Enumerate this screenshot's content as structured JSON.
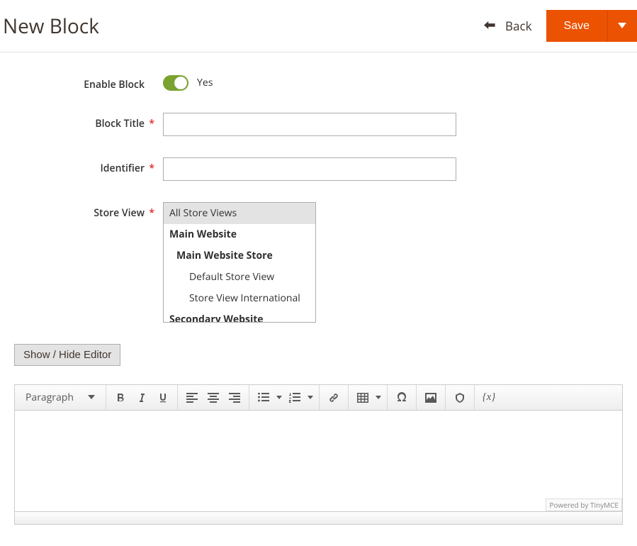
{
  "header": {
    "title": "New Block",
    "back": "Back",
    "save": "Save"
  },
  "fields": {
    "enable": {
      "label": "Enable Block",
      "value_label": "Yes"
    },
    "title": {
      "label": "Block Title"
    },
    "identifier": {
      "label": "Identifier"
    },
    "store": {
      "label": "Store View",
      "options": [
        {
          "label": "All Store Views",
          "depth": 0,
          "group": false,
          "selected": true
        },
        {
          "label": "Main Website",
          "depth": 0,
          "group": true,
          "selected": false
        },
        {
          "label": "Main Website Store",
          "depth": 1,
          "group": true,
          "selected": false
        },
        {
          "label": "Default Store View",
          "depth": 2,
          "group": false,
          "selected": false
        },
        {
          "label": "Store View International",
          "depth": 2,
          "group": false,
          "selected": false
        },
        {
          "label": "Secondary Website",
          "depth": 0,
          "group": true,
          "selected": false
        }
      ]
    }
  },
  "editor": {
    "toggle_label": "Show / Hide Editor",
    "format_label": "Paragraph",
    "powered": "Powered by TinyMCE"
  }
}
